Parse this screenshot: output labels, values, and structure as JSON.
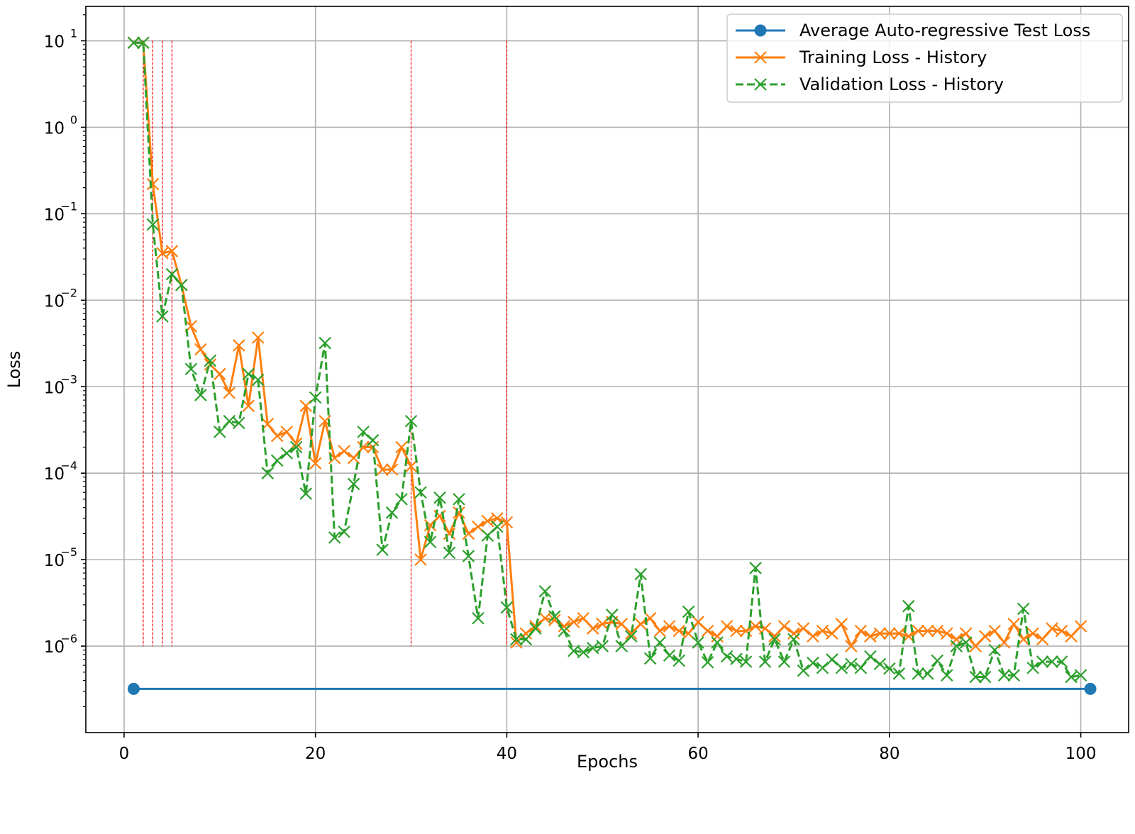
{
  "chart_data": {
    "type": "line",
    "title": "",
    "xlabel": "Epochs",
    "ylabel": "Loss",
    "xlim": [
      -4,
      105
    ],
    "ylim": [
      1e-07,
      25
    ],
    "yscale": "log",
    "grid": true,
    "legend_position": "top-right",
    "x_ticks": [
      0,
      20,
      40,
      60,
      80,
      100
    ],
    "x_tick_labels": [
      "0",
      "20",
      "40",
      "60",
      "80",
      "100"
    ],
    "y_ticks": [
      {
        "value": 10,
        "base": "10",
        "exp": "1"
      },
      {
        "value": 1,
        "base": "10",
        "exp": "0"
      },
      {
        "value": 0.1,
        "base": "10",
        "exp": "−1"
      },
      {
        "value": 0.01,
        "base": "10",
        "exp": "−2"
      },
      {
        "value": 0.001,
        "base": "10",
        "exp": "−3"
      },
      {
        "value": 0.0001,
        "base": "10",
        "exp": "−4"
      },
      {
        "value": 1e-05,
        "base": "10",
        "exp": "−5"
      },
      {
        "value": 1e-06,
        "base": "10",
        "exp": "−6"
      }
    ],
    "vertical_markers": {
      "color": "#ff0000",
      "x": [
        2,
        3,
        4,
        5,
        30,
        40
      ],
      "y_range": [
        1e-06,
        10
      ]
    },
    "series": [
      {
        "name": "Average Auto-regressive Test Loss",
        "color": "#1f77b4",
        "marker": "circle",
        "linestyle": "solid",
        "x": [
          1,
          101
        ],
        "y": [
          3.2e-07,
          3.2e-07
        ]
      },
      {
        "name": "Training Loss - History",
        "color": "#ff7f0e",
        "marker": "x",
        "linestyle": "solid",
        "x": [
          1,
          2,
          3,
          4,
          5,
          6,
          7,
          8,
          9,
          10,
          11,
          12,
          13,
          14,
          15,
          16,
          17,
          18,
          19,
          20,
          21,
          22,
          23,
          24,
          25,
          26,
          27,
          28,
          29,
          30,
          31,
          32,
          33,
          34,
          35,
          36,
          37,
          38,
          39,
          40,
          41,
          42,
          43,
          44,
          45,
          46,
          47,
          48,
          49,
          50,
          51,
          52,
          53,
          54,
          55,
          56,
          57,
          58,
          59,
          60,
          61,
          62,
          63,
          64,
          65,
          66,
          67,
          68,
          69,
          70,
          71,
          72,
          73,
          74,
          75,
          76,
          77,
          78,
          79,
          80,
          81,
          82,
          83,
          84,
          85,
          86,
          87,
          88,
          89,
          90,
          91,
          92,
          93,
          94,
          95,
          96,
          97,
          98,
          99,
          100
        ],
        "y": [
          9.5,
          9.5,
          0.22,
          0.035,
          0.037,
          0.015,
          0.005,
          0.0027,
          0.0018,
          0.0014,
          0.00085,
          0.003,
          0.0006,
          0.0037,
          0.00037,
          0.00027,
          0.0003,
          0.00022,
          0.0006,
          0.00013,
          0.0004,
          0.00015,
          0.00018,
          0.00015,
          0.0002,
          0.0002,
          0.00011,
          0.00011,
          0.0002,
          0.00012,
          1e-05,
          2.5e-05,
          3.2e-05,
          2e-05,
          3.5e-05,
          2e-05,
          2.4e-05,
          2.8e-05,
          3e-05,
          2.7e-05,
          1.1e-06,
          1.4e-06,
          1.7e-06,
          2.1e-06,
          2e-06,
          1.7e-06,
          1.9e-06,
          2.1e-06,
          1.6e-06,
          1.8e-06,
          1.9e-06,
          1.8e-06,
          1.4e-06,
          1.8e-06,
          2.1e-06,
          1.5e-06,
          1.7e-06,
          1.5e-06,
          1.4e-06,
          1.9e-06,
          1.5e-06,
          1.3e-06,
          1.7e-06,
          1.5e-06,
          1.5e-06,
          1.7e-06,
          1.6e-06,
          1.3e-06,
          1.7e-06,
          1.4e-06,
          1.6e-06,
          1.3e-06,
          1.5e-06,
          1.4e-06,
          1.8e-06,
          1e-06,
          1.5e-06,
          1.3e-06,
          1.4e-06,
          1.4e-06,
          1.4e-06,
          1.3e-06,
          1.5e-06,
          1.5e-06,
          1.5e-06,
          1.4e-06,
          1.2e-06,
          1.4e-06,
          1e-06,
          1.3e-06,
          1.5e-06,
          1.1e-06,
          1.8e-06,
          1.2e-06,
          1.4e-06,
          1.2e-06,
          1.6e-06,
          1.5e-06,
          1.3e-06,
          1.7e-06
        ]
      },
      {
        "name": "Validation Loss - History",
        "color": "#2ca02c",
        "marker": "x",
        "linestyle": "dashed",
        "x": [
          1,
          2,
          3,
          4,
          5,
          6,
          7,
          8,
          9,
          10,
          11,
          12,
          13,
          14,
          15,
          16,
          17,
          18,
          19,
          20,
          21,
          22,
          23,
          24,
          25,
          26,
          27,
          28,
          29,
          30,
          31,
          32,
          33,
          34,
          35,
          36,
          37,
          38,
          39,
          40,
          41,
          42,
          43,
          44,
          45,
          46,
          47,
          48,
          49,
          50,
          51,
          52,
          53,
          54,
          55,
          56,
          57,
          58,
          59,
          60,
          61,
          62,
          63,
          64,
          65,
          66,
          67,
          68,
          69,
          70,
          71,
          72,
          73,
          74,
          75,
          76,
          77,
          78,
          79,
          80,
          81,
          82,
          83,
          84,
          85,
          86,
          87,
          88,
          89,
          90,
          91,
          92,
          93,
          94,
          95,
          96,
          97,
          98,
          99,
          100
        ],
        "y": [
          9.5,
          9.5,
          0.075,
          0.0065,
          0.02,
          0.015,
          0.0016,
          0.0008,
          0.002,
          0.0003,
          0.0004,
          0.00038,
          0.0014,
          0.0012,
          0.0001,
          0.00014,
          0.00017,
          0.0002,
          5.8e-05,
          0.00075,
          0.0032,
          1.8e-05,
          2.1e-05,
          7.5e-05,
          0.0003,
          0.00024,
          1.3e-05,
          3.5e-05,
          5e-05,
          0.0004,
          6e-05,
          1.6e-05,
          5.2e-05,
          1.2e-05,
          5e-05,
          1.1e-05,
          2.1e-06,
          1.9e-05,
          2.4e-05,
          2.8e-06,
          1.2e-06,
          1.2e-06,
          1.6e-06,
          4.3e-06,
          2.2e-06,
          1.5e-06,
          8.8e-07,
          8.5e-07,
          9.5e-07,
          1e-06,
          2.3e-06,
          1e-06,
          1.3e-06,
          6.8e-06,
          7.2e-07,
          1.1e-06,
          7.8e-07,
          6.8e-07,
          2.5e-06,
          1.1e-06,
          6.5e-07,
          1.1e-06,
          7.6e-07,
          7.1e-07,
          6.6e-07,
          8e-06,
          6.6e-07,
          1.2e-06,
          6.6e-07,
          1.2e-06,
          5.2e-07,
          6.4e-07,
          5.6e-07,
          7e-07,
          5.6e-07,
          6.2e-07,
          5.6e-07,
          7.6e-07,
          6.2e-07,
          5.5e-07,
          4.8e-07,
          2.9e-06,
          4.8e-07,
          4.8e-07,
          6.8e-07,
          4.6e-07,
          1e-06,
          1.1e-06,
          4.4e-07,
          4.4e-07,
          9e-07,
          4.6e-07,
          4.6e-07,
          2.7e-06,
          5.6e-07,
          6.6e-07,
          6.6e-07,
          6.6e-07,
          4.4e-07,
          4.6e-07
        ]
      }
    ]
  }
}
